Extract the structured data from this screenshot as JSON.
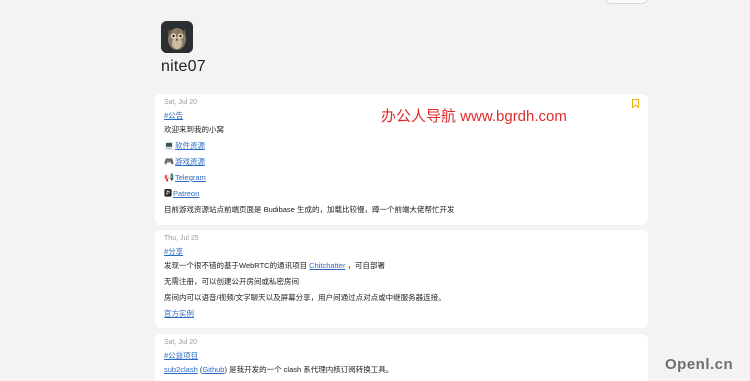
{
  "channel": {
    "name": "nite07"
  },
  "overlay": {
    "red_text": "办公人导航 www.bgrdh.com"
  },
  "watermark": "Openl.cn",
  "icons": {
    "bookmark": "bookmark-icon",
    "laptop": "laptop-icon",
    "gamepad": "gamepad-icon",
    "megaphone": "megaphone-icon",
    "patreon": "patreon-icon"
  },
  "colors": {
    "link": "#2c6cc4",
    "overlay": "#e02a2a",
    "bookmark": "#e9b012"
  },
  "posts": [
    {
      "date": "Sat, Jul 20",
      "tag": "#公告",
      "welcome": "欢迎来到我的小窝",
      "links": [
        "💻",
        "软件资源",
        "🎮",
        "游戏资源",
        "📢",
        "Telegram",
        "🅿",
        "Patreon"
      ],
      "footer": "目前游戏资源站点前端页面是 Budibase 生成的，加载比较慢，蹲一个前端大佬帮忙开发"
    },
    {
      "date": "Thu, Jul 25",
      "tag": "#分享",
      "line1_pre": "发现一个很不错的基于WebRTC的通讯项目",
      "line1_link": "Chitchatter",
      "line1_post": "，可自部署",
      "line2": "无需注册，可以创建公开房间或私密房间",
      "line3": "房间内可以语音/视频/文字聊天以及屏幕分享，用户间通过点对点或中继服务器连接。",
      "line4_link": "官方实例"
    },
    {
      "date": "Sat, Jul 20",
      "tag": "#公益项目",
      "link1": "sub2clash",
      "paren_open": "(",
      "link2": "Github",
      "paren_close": ")",
      "desc": "是我开发的一个 clash 系代理内核订阅转换工具。"
    }
  ]
}
